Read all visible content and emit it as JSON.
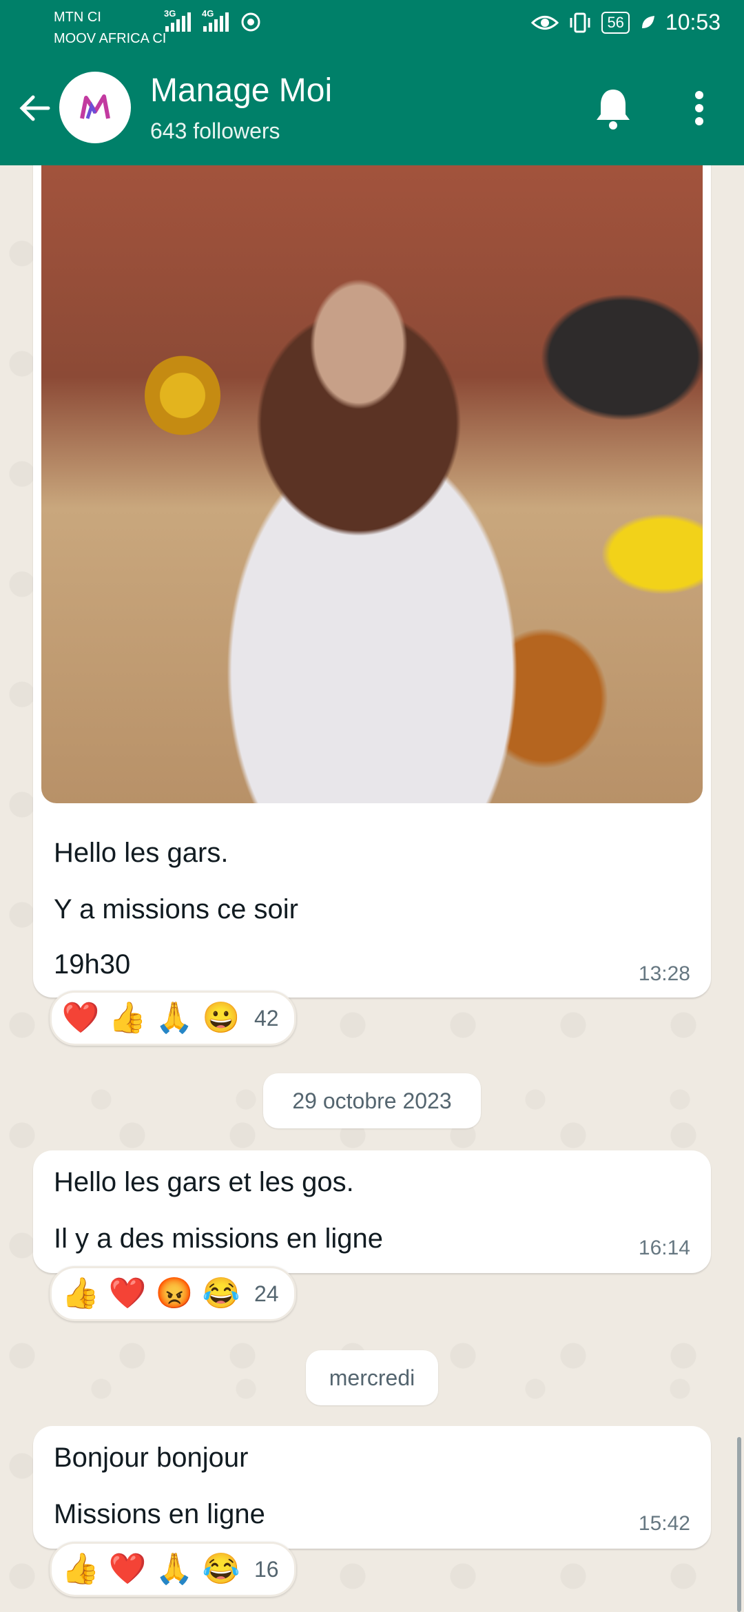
{
  "status_bar": {
    "carrier_1": "MTN CI",
    "carrier_2": "MOOV AFRICA CI",
    "net_1": "3G",
    "net_2": "4G",
    "battery": "56",
    "time": "10:53"
  },
  "header": {
    "title": "Manage Moi",
    "subtitle": "643 followers",
    "avatar_icon": "manage-moi-logo",
    "accent": "#008069"
  },
  "messages": [
    {
      "has_image": true,
      "lines": [
        "Hello les gars.",
        "Y a missions ce soir",
        "19h30"
      ],
      "time": "13:28",
      "reactions": [
        "❤️",
        "👍",
        "🙏",
        "😀"
      ],
      "reaction_count": "42"
    },
    {
      "date_divider": "29 octobre 2023",
      "lines": [
        "Hello les gars et les gos.",
        "Il y a des missions en ligne"
      ],
      "time": "16:14",
      "reactions": [
        "👍",
        "❤️",
        "😡",
        "😂"
      ],
      "reaction_count": "24"
    },
    {
      "date_divider": "mercredi",
      "lines": [
        "Bonjour bonjour",
        "Missions en ligne"
      ],
      "time": "15:42",
      "reactions": [
        "👍",
        "❤️",
        "🙏",
        "😂"
      ],
      "reaction_count": "16"
    }
  ]
}
